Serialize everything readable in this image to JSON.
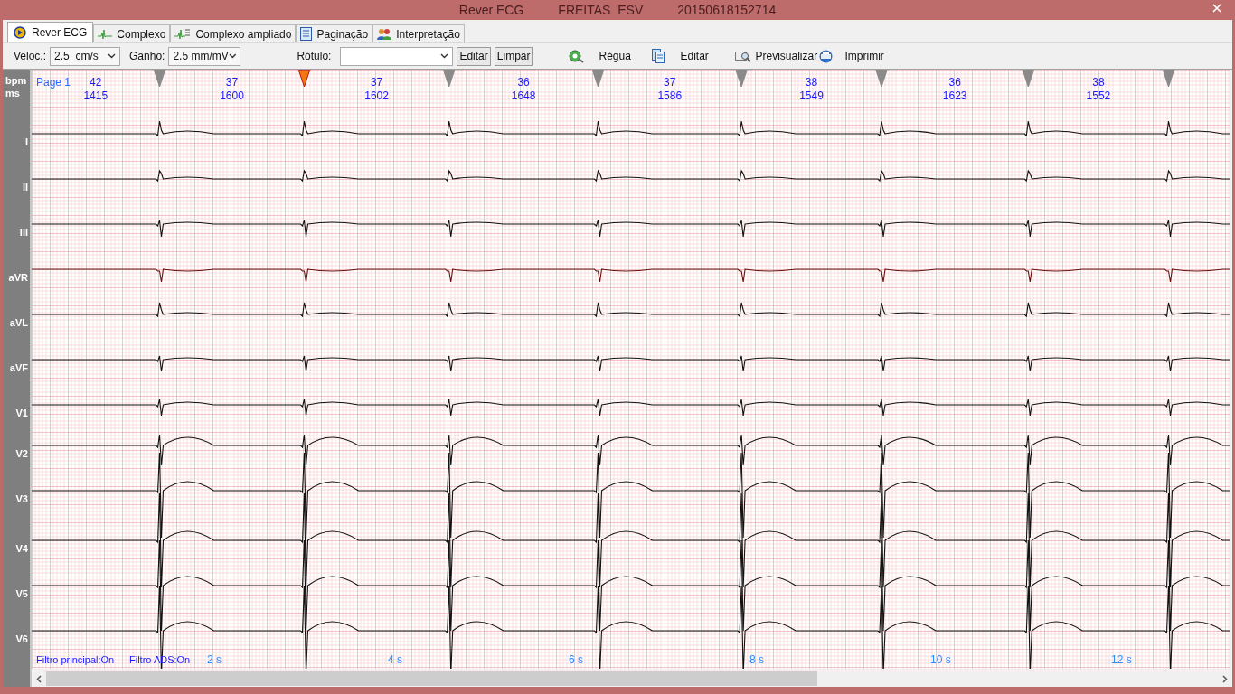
{
  "window": {
    "title": [
      "Rever ECG",
      "FREITAS  ESV",
      "20150618152714"
    ]
  },
  "tabs": [
    {
      "label": "Rever ECG",
      "kind": "play",
      "selected": true
    },
    {
      "label": "Complexo",
      "kind": "wave",
      "selected": false
    },
    {
      "label": "Complexo ampliado",
      "kind": "wavezoom",
      "selected": false
    },
    {
      "label": "Paginação",
      "kind": "page",
      "selected": false
    },
    {
      "label": "Interpretação",
      "kind": "people",
      "selected": false
    }
  ],
  "toolbar": {
    "speed": {
      "label": "Veloc.:",
      "value": "2.5  cm/s"
    },
    "gain": {
      "label": "Ganho:",
      "value": "2.5 mm/mV"
    },
    "tag": {
      "label": "Rótulo:"
    },
    "buttons": [
      "Editar",
      "Limpar"
    ],
    "tools": [
      {
        "label": "Régua",
        "kind": "ruler"
      },
      {
        "label": "Editar",
        "kind": "edit"
      },
      {
        "label": "Previsualizar",
        "kind": "preview"
      },
      {
        "label": "Imprimir",
        "kind": "print"
      }
    ]
  },
  "ecg": {
    "axis_labels": [
      "bpm",
      "ms"
    ],
    "page": "Page 1",
    "beats": [
      {
        "bpm": "42",
        "ms": "1415",
        "selected": false
      },
      {
        "bpm": "37",
        "ms": "1600",
        "selected": true
      },
      {
        "bpm": "37",
        "ms": "1602",
        "selected": false
      },
      {
        "bpm": "36",
        "ms": "1648",
        "selected": false
      },
      {
        "bpm": "37",
        "ms": "1586",
        "selected": false
      },
      {
        "bpm": "38",
        "ms": "1549",
        "selected": false
      },
      {
        "bpm": "36",
        "ms": "1623",
        "selected": false
      },
      {
        "bpm": "38",
        "ms": "1552",
        "selected": false
      }
    ],
    "leads": [
      "I",
      "II",
      "III",
      "aVR",
      "aVL",
      "aVF",
      "V1",
      "V2",
      "V3",
      "V4",
      "V5",
      "V6"
    ],
    "filters": [
      "Filtro principal:On",
      "Filtro ADS:On"
    ],
    "time_labels": [
      "2 s",
      "4 s",
      "6 s",
      "8 s",
      "10 s",
      "12 s"
    ]
  }
}
